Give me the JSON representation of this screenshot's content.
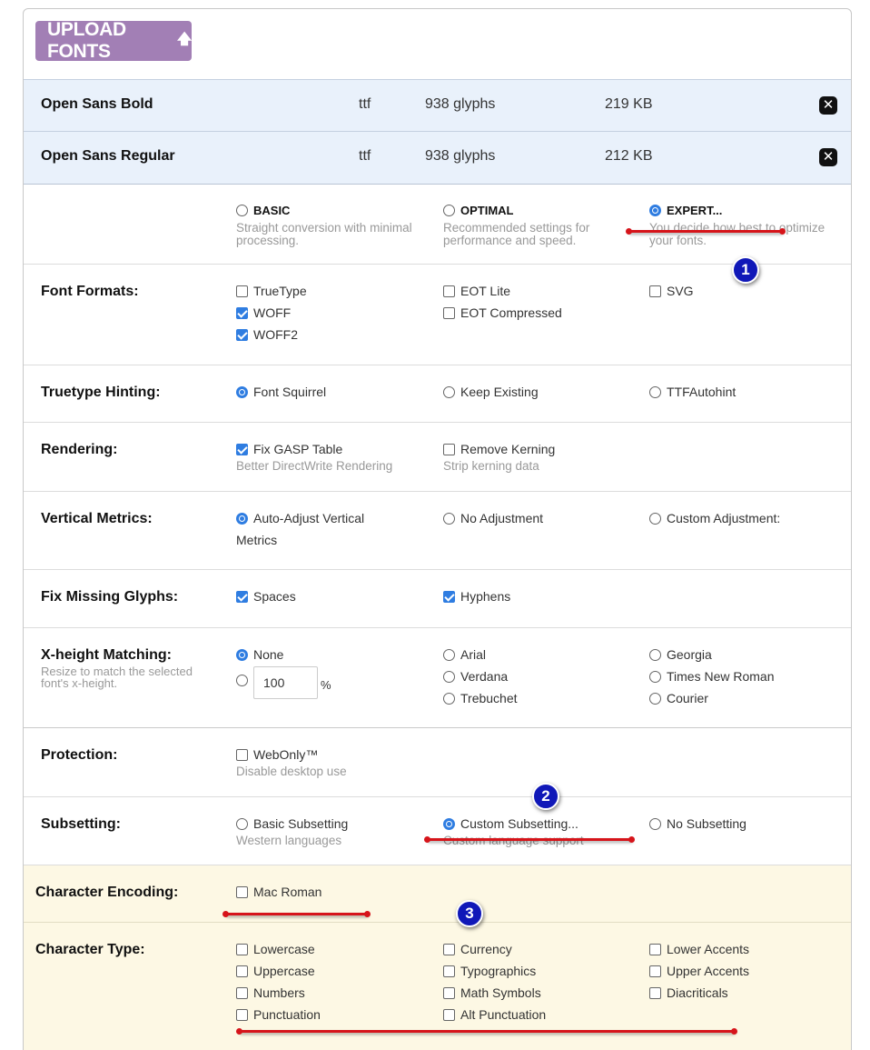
{
  "upload": {
    "label": "UPLOAD FONTS",
    "icon": "arrow-up-icon"
  },
  "files": [
    {
      "name": "Open Sans Bold",
      "type": "ttf",
      "glyphs": "938 glyphs",
      "size": "219 KB"
    },
    {
      "name": "Open Sans Regular",
      "type": "ttf",
      "glyphs": "938 glyphs",
      "size": "212 KB"
    }
  ],
  "modes": [
    {
      "label": "BASIC",
      "desc": "Straight conversion with minimal processing.",
      "selected": false
    },
    {
      "label": "OPTIMAL",
      "desc": "Recommended settings for performance and speed.",
      "selected": false
    },
    {
      "label": "EXPERT...",
      "desc": "You decide how best to optimize your fonts.",
      "selected": true
    }
  ],
  "font_formats": {
    "label": "Font Formats:",
    "options": [
      "TrueType",
      "WOFF",
      "WOFF2",
      "EOT Lite",
      "EOT Compressed",
      "SVG"
    ],
    "checked": [
      false,
      true,
      true,
      false,
      false,
      false
    ]
  },
  "hinting": {
    "label": "Truetype Hinting:",
    "options": [
      "Font Squirrel",
      "Keep Existing",
      "TTFAutohint"
    ],
    "selected": "Font Squirrel"
  },
  "rendering": {
    "label": "Rendering:",
    "options": [
      {
        "label": "Fix GASP Table",
        "desc": "Better DirectWrite Rendering",
        "checked": true
      },
      {
        "label": "Remove Kerning",
        "desc": "Strip kerning data",
        "checked": false
      }
    ]
  },
  "vertical_metrics": {
    "label": "Vertical Metrics:",
    "options": [
      "Auto-Adjust Vertical",
      "Metrics",
      "No Adjustment",
      "Custom Adjustment:"
    ],
    "selected": "Auto-Adjust Vertical Metrics"
  },
  "missing_glyphs": {
    "label": "Fix Missing Glyphs:",
    "options": [
      "Spaces",
      "Hyphens"
    ],
    "checked": [
      true,
      true
    ]
  },
  "xheight": {
    "label": "X-height Matching:",
    "sublabel": "Resize to match the selected font's x-height.",
    "options": [
      "None",
      "Arial",
      "Verdana",
      "Trebuchet",
      "Georgia",
      "Times New Roman",
      "Courier"
    ],
    "selected": "None",
    "percent_value": "100",
    "percent_unit": "%"
  },
  "protection": {
    "label": "Protection:",
    "option": "WebOnly™",
    "desc": "Disable desktop use",
    "checked": false
  },
  "subsetting": {
    "label": "Subsetting:",
    "options": [
      {
        "label": "Basic Subsetting",
        "desc": "Western languages"
      },
      {
        "label": "Custom Subsetting...",
        "desc": "Custom language support"
      },
      {
        "label": "No Subsetting",
        "desc": ""
      }
    ],
    "selected": "Custom Subsetting..."
  },
  "encoding": {
    "label": "Character Encoding:",
    "option": "Mac Roman",
    "checked": false
  },
  "char_type": {
    "label": "Character Type:",
    "options": [
      "Lowercase",
      "Uppercase",
      "Numbers",
      "Punctuation",
      "Currency",
      "Typographics",
      "Math Symbols",
      "Alt Punctuation",
      "Lower Accents",
      "Upper Accents",
      "Diacriticals"
    ]
  },
  "annotations": {
    "badge1": "1",
    "badge2": "2",
    "badge3": "3"
  },
  "colors": {
    "upload_bg": "#a27fb5",
    "file_row_bg": "#e9f1fb",
    "band_bg": "#fdf8e4",
    "accent": "#2f7de1",
    "annotation_red": "#d6141a",
    "badge_blue": "#1018b8"
  }
}
